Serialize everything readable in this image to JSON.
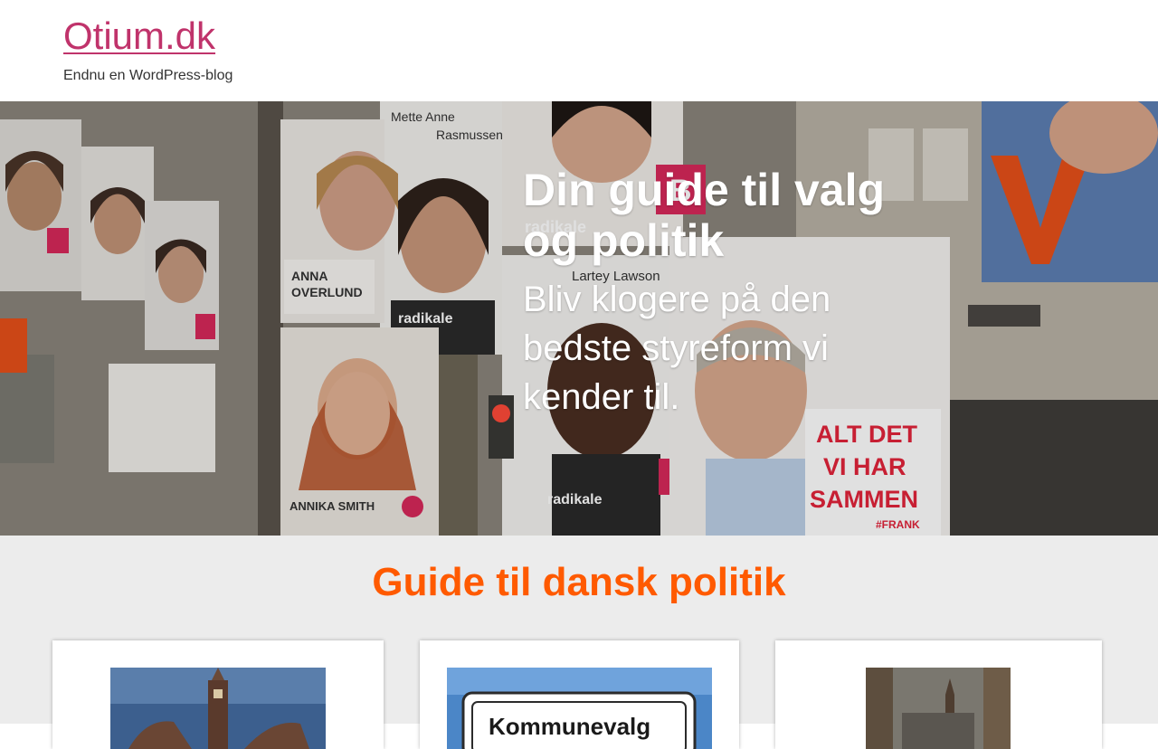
{
  "header": {
    "site_title": "Otium.dk",
    "tagline": "Endnu en WordPress-blog"
  },
  "hero": {
    "title": "Din guide til valg og politik",
    "subtitle": "Bliv klogere på den bedste styreform vi kender til.",
    "poster_texts": {
      "mette": "Mette Anne",
      "rasmussen": "Rasmussen",
      "radikale_1": "radikale",
      "anna": "ANNA",
      "overlund": "OVERLUND",
      "radikale_2": "radikale",
      "lartey": "Lartey Lawson",
      "radikale_3": "radikale",
      "annika": "ANNIKA SMITH",
      "alt_det": "ALT DET",
      "vi_har": "VI HAR",
      "sammen": "SAMMEN",
      "frank": "#FRANK",
      "letter_b": "B",
      "letter_v": "V"
    }
  },
  "guide": {
    "heading": "Guide til dansk politik",
    "cards": [
      {
        "image": "parliament-building-photo"
      },
      {
        "image": "kommunevalg-sign-photo",
        "sign_text": "Kommunevalg"
      },
      {
        "image": "city-street-photo"
      }
    ]
  },
  "colors": {
    "site_title": "#c0336b",
    "heading_orange": "#ff5a00",
    "section_bg": "#ececec",
    "party_pink": "#d8285a",
    "venstre_orange": "#e8501a"
  }
}
